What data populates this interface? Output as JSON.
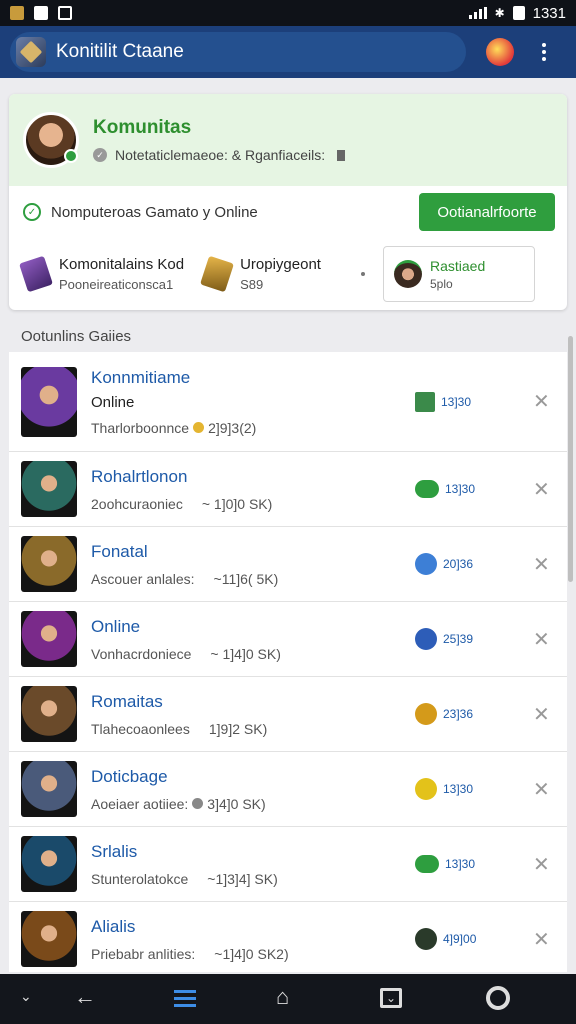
{
  "status_bar": {
    "time": "1331",
    "left_icons": [
      "app-notification-icon",
      "photo-icon",
      "news-icon"
    ],
    "right_icons": [
      "signal-icon",
      "bluetooth-icon",
      "battery-icon"
    ]
  },
  "app_bar": {
    "title": "Konitilit Ctaane",
    "icons": [
      "app-logo-icon",
      "gift-icon",
      "more-vertical-icon"
    ]
  },
  "profile": {
    "name": "Komunitas",
    "subtitle": "Notetaticlemaeoe: & Rganfiaceils:",
    "status": "Nomputeroas Gamato y Online",
    "button": "Ootianalrfoorte",
    "stat1_title": "Komonitalains Kod",
    "stat1_sub": "Pooneireaticonsca1",
    "stat2_title": "Uropiygeont",
    "stat2_sub": "S89",
    "recent_title": "Rastiaed",
    "recent_sub": "5plo"
  },
  "section_title": "Ootunlins Gaiies",
  "games": [
    {
      "title": "Konnmitiame",
      "subtitle": "Online",
      "meta": "Tharlorboonnce",
      "meta_value": "2]9]3(2)",
      "badge": "13]30",
      "thumb": "#6a3aa0",
      "badge_icon": "image-icon",
      "badge_color": "#3b8a4a"
    },
    {
      "title": "Rohalrtlonon",
      "subtitle": "",
      "meta": "2oohcuraoniec",
      "meta_value": "~ 1]0]0 SK)",
      "badge": "13]30",
      "thumb": "#2a6a60",
      "badge_icon": "chat-icon",
      "badge_color": "#2e9e3f"
    },
    {
      "title": "Fonatal",
      "subtitle": "",
      "meta": "Ascouer anlales:",
      "meta_value": "~11]6( 5K)",
      "badge": "20]36",
      "thumb": "#8a6a2a",
      "badge_icon": "globe-icon",
      "badge_color": "#3d7fd6"
    },
    {
      "title": "Online",
      "subtitle": "",
      "meta": "Vonhacrdoniece",
      "meta_value": "~ 1]4]0 SK)",
      "badge": "25]39",
      "thumb": "#7a2a8a",
      "badge_icon": "avatar-icon",
      "badge_color": "#2d5db8"
    },
    {
      "title": "Romaitas",
      "subtitle": "",
      "meta": "Tlahecoaonlees",
      "meta_value": "1]9]2 SK)",
      "badge": "23]36",
      "thumb": "#6a4a2a",
      "badge_icon": "coin-icon",
      "badge_color": "#d49a1a"
    },
    {
      "title": "Doticbage",
      "subtitle": "",
      "meta": "Aoeiaer aotiiee:",
      "meta_value": "3]4]0 SK)",
      "badge": "13]30",
      "thumb": "#4a5a7a",
      "badge_icon": "search-icon",
      "badge_color": "#e3c21a"
    },
    {
      "title": "Srlalis",
      "subtitle": "",
      "meta": "Stunterolatokce",
      "meta_value": "~1]3]4] SK)",
      "badge": "13]30",
      "thumb": "#1a4a6a",
      "badge_icon": "chat-icon",
      "badge_color": "#2e9e3f"
    },
    {
      "title": "Alialis",
      "subtitle": "",
      "meta": "Priebabr anlities:",
      "meta_value": "~1]4]0 SK2)",
      "badge": "4]9]00",
      "thumb": "#7a4a1a",
      "badge_icon": "avatar-icon",
      "badge_color": "#2a3a2a"
    }
  ],
  "nav": [
    "chevron-down-icon",
    "back-icon",
    "menu-icon",
    "home-icon",
    "inbox-icon",
    "settings-icon"
  ]
}
